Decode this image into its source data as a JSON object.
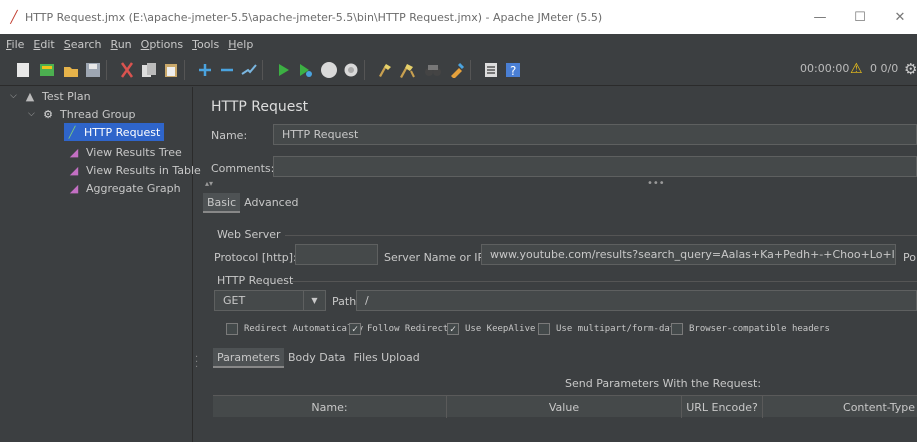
{
  "window": {
    "title": "HTTP Request.jmx (E:\\apache-jmeter-5.5\\apache-jmeter-5.5\\bin\\HTTP Request.jmx) - Apache JMeter (5.5)",
    "minimize": "—",
    "maximize": "☐",
    "close": "✕"
  },
  "menu": [
    {
      "label_u": "F",
      "label_rest": "ile"
    },
    {
      "label_u": "E",
      "label_rest": "dit"
    },
    {
      "label_u": "S",
      "label_rest": "earch"
    },
    {
      "label_u": "R",
      "label_rest": "un"
    },
    {
      "label_u": "O",
      "label_rest": "ptions"
    },
    {
      "label_u": "T",
      "label_rest": "ools"
    },
    {
      "label_u": "H",
      "label_rest": "elp"
    }
  ],
  "toolbar": {
    "timer": "00:00:00",
    "count": "0  0/0"
  },
  "tree": {
    "items": [
      {
        "label": "Test Plan"
      },
      {
        "label": "Thread Group"
      },
      {
        "label": "HTTP Request"
      },
      {
        "label": "View Results Tree"
      },
      {
        "label": "View Results in Table"
      },
      {
        "label": "Aggregate Graph"
      }
    ]
  },
  "panel": {
    "title": "HTTP Request",
    "name_label": "Name:",
    "name_value": "HTTP Request",
    "comments_label": "Comments:",
    "comments_value": "",
    "tabs": {
      "basic": "Basic",
      "advanced": "Advanced"
    },
    "web_server": {
      "group_label": "Web Server",
      "protocol_label": "Protocol [http]:",
      "protocol_value": "",
      "server_label": "Server Name or IP:",
      "server_value": "www.youtube.com/results?search_query=Aalas+Ka+Pedh+-+Choo+Lo+live",
      "port_label": "Po"
    },
    "http_request": {
      "group_label": "HTTP Request",
      "method": "GET",
      "path_label": "Path:",
      "path_value": "/"
    },
    "checkboxes": [
      {
        "label": "Redirect Automatically",
        "checked": false
      },
      {
        "label": "Follow Redirects",
        "checked": true
      },
      {
        "label": "Use KeepAlive",
        "checked": true
      },
      {
        "label": "Use multipart/form-data",
        "checked": false
      },
      {
        "label": "Browser-compatible headers",
        "checked": false
      }
    ],
    "subtabs": {
      "parameters": "Parameters",
      "body": "Body Data",
      "files": "Files Upload"
    },
    "table": {
      "caption": "Send Parameters With the Request:",
      "columns": [
        "Name:",
        "Value",
        "URL Encode?",
        "Content-Type"
      ]
    }
  }
}
